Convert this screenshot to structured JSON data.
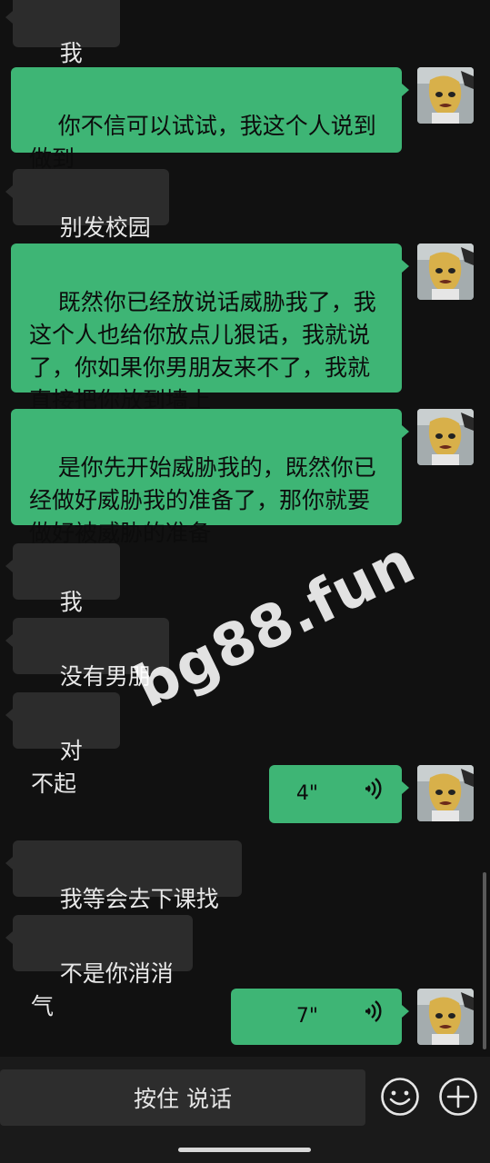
{
  "messages": [
    {
      "side": "left",
      "text": "我求你"
    },
    {
      "side": "right",
      "text": "你不信可以试试，我这个人说到做到"
    },
    {
      "side": "left",
      "text": "别发校园墙"
    },
    {
      "side": "right",
      "text": "既然你已经放说话威胁我了，我这个人也给你放点儿狠话，我就说了，你如果你男朋友来不了，我就直接把你放到墙上"
    },
    {
      "side": "right",
      "text": "是你先开始威胁我的，既然你已经做好威胁我的准备了，那你就要做好被威胁的准备"
    },
    {
      "side": "left",
      "text": "我装逼"
    },
    {
      "side": "left",
      "text": "没有男朋友"
    },
    {
      "side": "left",
      "text": "对不起"
    },
    {
      "side": "right",
      "type": "voice",
      "text": "4\""
    },
    {
      "side": "left",
      "text": "我等会去下课找你"
    },
    {
      "side": "left",
      "text": "不是你消消气"
    },
    {
      "side": "right",
      "type": "voice",
      "text": "7\""
    }
  ],
  "watermark": "bg88.fun",
  "input_bar": {
    "hold_to_talk_label": "按住 说话",
    "emoji_icon": "emoji-icon",
    "plus_icon": "plus-icon"
  },
  "colors": {
    "background": "#111111",
    "incoming_bubble": "#2c2c2c",
    "outgoing_bubble": "#3eb575"
  }
}
